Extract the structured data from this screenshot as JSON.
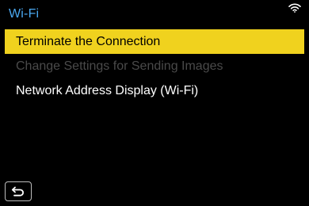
{
  "header": {
    "title": "Wi-Fi",
    "status_icon": "wifi-icon"
  },
  "menu": {
    "items": [
      {
        "label": "Terminate the Connection",
        "state": "selected"
      },
      {
        "label": "Change Settings for Sending Images",
        "state": "disabled"
      },
      {
        "label": "Network Address Display (Wi-Fi)",
        "state": "enabled"
      }
    ]
  },
  "footer": {
    "back_icon": "return-icon"
  },
  "colors": {
    "accent_title": "#4aa8f0",
    "highlight": "#f0d21e",
    "disabled_text": "#4a4a4a",
    "background": "#000000"
  }
}
